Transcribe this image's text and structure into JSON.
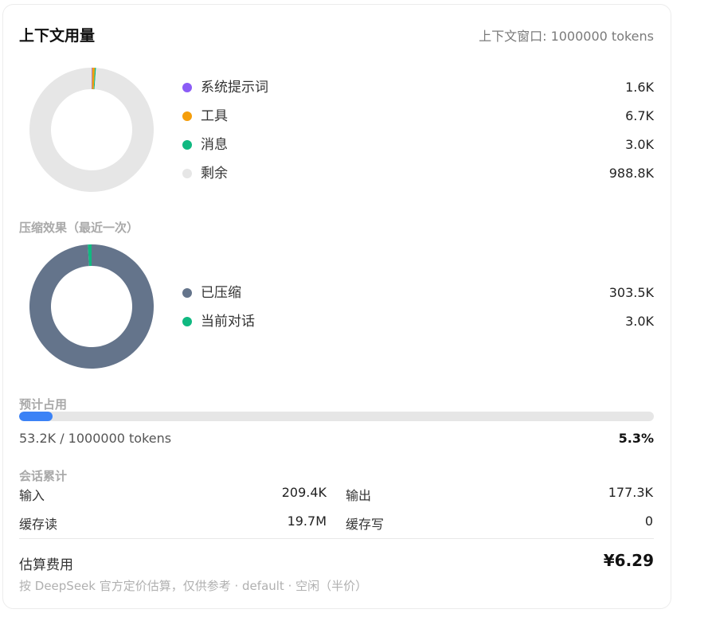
{
  "header": {
    "title": "上下文用量",
    "window_info": "上下文窗口: 1000000 tokens"
  },
  "usage": {
    "items": [
      {
        "label": "系统提示词",
        "value": "1.6K",
        "amount": 1.6,
        "color": "#8b5cf6"
      },
      {
        "label": "工具",
        "value": "6.7K",
        "amount": 6.7,
        "color": "#f59e0b"
      },
      {
        "label": "消息",
        "value": "3.0K",
        "amount": 3.0,
        "color": "#10b981"
      },
      {
        "label": "剩余",
        "value": "988.8K",
        "amount": 988.8,
        "color": "#e6e6e6"
      }
    ]
  },
  "compression": {
    "section_label": "压缩效果（最近一次）",
    "items": [
      {
        "label": "已压缩",
        "value": "303.5K",
        "amount": 303.5,
        "color": "#64748b"
      },
      {
        "label": "当前对话",
        "value": "3.0K",
        "amount": 3.0,
        "color": "#10b981"
      }
    ]
  },
  "projection": {
    "section_label": "预计占用",
    "text": "53.2K / 1000000 tokens",
    "percent_label": "5.3%",
    "fraction": 0.053,
    "bar_color": "#3b82f6"
  },
  "session": {
    "section_label": "会话累计",
    "input_label": "输入",
    "input_value": "209.4K",
    "output_label": "输出",
    "output_value": "177.3K",
    "cache_read_label": "缓存读",
    "cache_read_value": "19.7M",
    "cache_write_label": "缓存写",
    "cache_write_value": "0"
  },
  "cost": {
    "label": "估算费用",
    "value": "¥6.29",
    "footnote": "按 DeepSeek 官方定价估算，仅供参考 · default · 空闲（半价）"
  }
}
